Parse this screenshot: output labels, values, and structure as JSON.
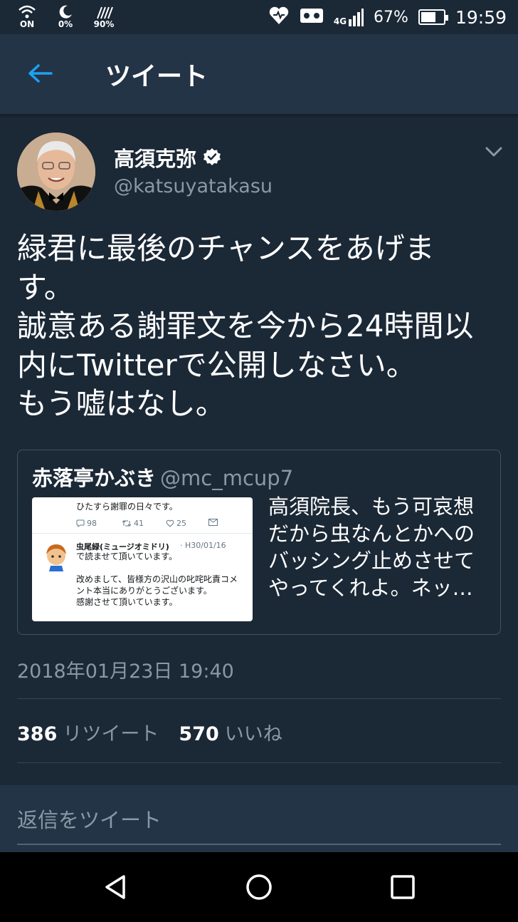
{
  "status_bar": {
    "left_items": [
      {
        "icon": "wifi-on-icon",
        "glyph": "◡",
        "caption": "ON"
      },
      {
        "icon": "moon-icon",
        "glyph": "☾",
        "caption": "0%"
      },
      {
        "icon": "rain-icon",
        "glyph": "⁂",
        "caption": "90%"
      }
    ],
    "network": "4G",
    "battery_percent": "67%",
    "battery_level": 0.67,
    "time": "19:59"
  },
  "header": {
    "back_icon": "back-arrow-icon",
    "title": "ツイート",
    "accent": "#1da1f2"
  },
  "tweet": {
    "author_name": "高須克弥",
    "author_handle": "@katsuyatakasu",
    "verified_icon": "verified-badge-icon",
    "menu_icon": "chevron-down-icon",
    "text": "緑君に最後のチャンスをあげま\nす。\n誠意ある謝罪文を今から24時間以\n内にTwitterで公開しなさい。\nもう嘘はなし。",
    "timestamp": "2018年01月23日 19:40",
    "retweet_count": "386",
    "retweet_label": "リツイート",
    "like_count": "570",
    "like_label": "いいね"
  },
  "quoted_tweet": {
    "author_name": "赤落亭かぶき",
    "author_handle": "@mc_mcup7",
    "text": "高須院長、もう可哀想\nだから虫なんとかへの\nバッシング止めさせて\nやってくれよ。ネッ…",
    "screenshot": {
      "top_line": "ひたすら謝罪の日々です。",
      "replies": "98",
      "retweets": "41",
      "likes": "25",
      "inner_name": "虫尾緑(ミュージオミドリ)",
      "inner_date": "· H30/01/16",
      "lines": [
        "で読ませて頂いています。",
        "",
        "改めまして、皆様方の沢山の叱咤叱責コメ",
        "ント本当にありがとうございます。",
        "感謝させて頂いています。"
      ]
    }
  },
  "reply": {
    "placeholder": "返信をツイート"
  },
  "nav": {
    "back_icon": "nav-back-icon",
    "home_icon": "nav-home-icon",
    "recents_icon": "nav-recents-icon"
  }
}
